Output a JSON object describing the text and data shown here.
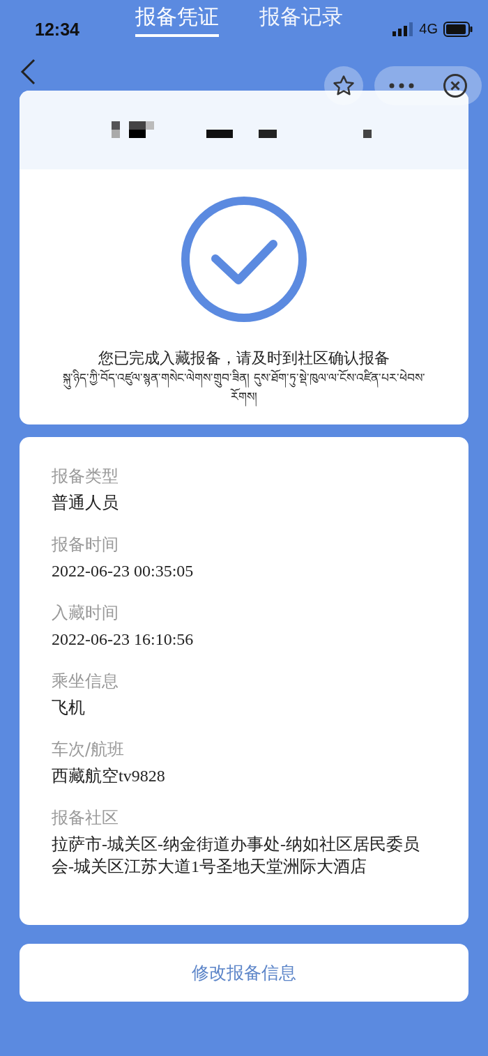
{
  "status_bar": {
    "time": "12:34",
    "network": "4G"
  },
  "tabs": [
    {
      "label": "报备凭证",
      "selected": true
    },
    {
      "label": "报备记录",
      "selected": false
    }
  ],
  "result": {
    "message": "您已完成入藏报备，请及时到社区确认报备",
    "message_tibetan": "སྐུ་ཉིད་ཀྱི་བོད་འཛུལ་སྙན་གསེང་ལེགས་གྲུབ་ཟིན། དུས་ཐོག་ཏུ་སྡེ་ཁུལ་ལ་ངོས་འཛིན་པར་ཕེབས་རོགས།"
  },
  "details": [
    {
      "label": "报备类型",
      "value": "普通人员"
    },
    {
      "label": "报备时间",
      "value": "2022-06-23 00:35:05"
    },
    {
      "label": "入藏时间",
      "value": "2022-06-23 16:10:56"
    },
    {
      "label": "乘坐信息",
      "value": "飞机"
    },
    {
      "label": "车次/航班",
      "value": "西藏航空tv9828"
    },
    {
      "label": "报备社区",
      "value": "拉萨市-城关区-纳金街道办事处-纳如社区居民委员会-城关区江苏大道1号圣地天堂洲际大酒店"
    }
  ],
  "edit_button": "修改报备信息"
}
